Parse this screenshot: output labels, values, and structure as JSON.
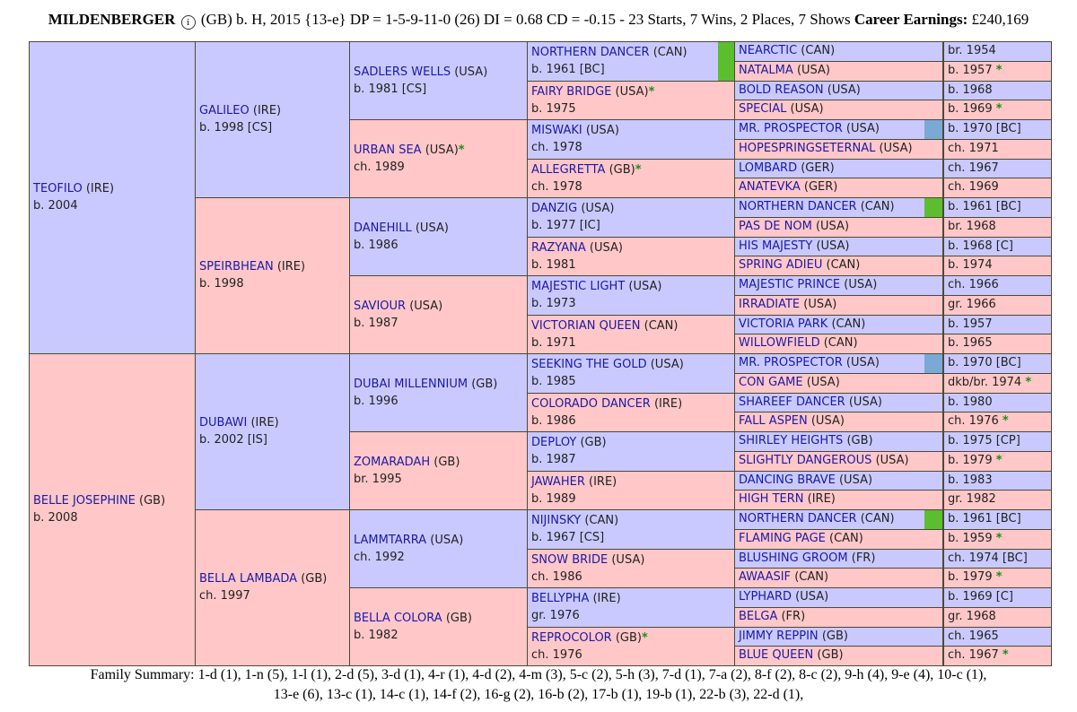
{
  "header": {
    "name": "MILDENBERGER",
    "info_icon": "info-icon",
    "details": "(GB) b. H, 2015 {13-e} DP = 1-5-9-11-0 (26) DI = 0.68   CD = -0.15 - 23 Starts, 7 Wins, 2 Places, 7 Shows",
    "earnings_label": "Career Earnings:",
    "earnings_value": "£240,169"
  },
  "pedigree": {
    "g1": [
      {
        "name": "TEOFILO",
        "country": "(IRE)",
        "info": "b. 2004",
        "sex": "m",
        "star": false
      },
      {
        "name": "BELLE JOSEPHINE",
        "country": "(GB)",
        "info": "b. 2008",
        "sex": "f",
        "star": false
      }
    ],
    "g2": [
      {
        "name": "GALILEO",
        "country": "(IRE)",
        "info": "b. 1998 [CS]",
        "sex": "m",
        "star": false
      },
      {
        "name": "SPEIRBHEAN",
        "country": "(IRE)",
        "info": "b. 1998",
        "sex": "f",
        "star": false
      },
      {
        "name": "DUBAWI",
        "country": "(IRE)",
        "info": "b. 2002 [IS]",
        "sex": "m",
        "star": false
      },
      {
        "name": "BELLA LAMBADA",
        "country": "(GB)",
        "info": "ch. 1997",
        "sex": "f",
        "star": false
      }
    ],
    "g3": [
      {
        "name": "SADLERS WELLS",
        "country": "(USA)",
        "info": "b. 1981 [CS]",
        "sex": "m",
        "star": false
      },
      {
        "name": "URBAN SEA",
        "country": "(USA)",
        "info": "ch. 1989",
        "sex": "f",
        "star": true
      },
      {
        "name": "DANEHILL",
        "country": "(USA)",
        "info": "b. 1986",
        "sex": "m",
        "star": false
      },
      {
        "name": "SAVIOUR",
        "country": "(USA)",
        "info": "b. 1987",
        "sex": "f",
        "star": false
      },
      {
        "name": "DUBAI MILLENNIUM",
        "country": "(GB)",
        "info": "b. 1996",
        "sex": "m",
        "star": false
      },
      {
        "name": "ZOMARADAH",
        "country": "(GB)",
        "info": "br. 1995",
        "sex": "f",
        "star": false
      },
      {
        "name": "LAMMTARRA",
        "country": "(USA)",
        "info": "ch. 1992",
        "sex": "m",
        "star": false
      },
      {
        "name": "BELLA COLORA",
        "country": "(GB)",
        "info": "b. 1982",
        "sex": "f",
        "star": false
      }
    ],
    "g4": [
      {
        "name": "NORTHERN DANCER",
        "country": "(CAN)",
        "info": "b. 1961 [BC]",
        "sex": "m",
        "star": false,
        "swatch": "#5cbd2e"
      },
      {
        "name": "FAIRY BRIDGE",
        "country": "(USA)",
        "info": "b. 1975",
        "sex": "f",
        "star": true
      },
      {
        "name": "MISWAKI",
        "country": "(USA)",
        "info": "ch. 1978",
        "sex": "m",
        "star": false
      },
      {
        "name": "ALLEGRETTA",
        "country": "(GB)",
        "info": "ch. 1978",
        "sex": "f",
        "star": true
      },
      {
        "name": "DANZIG",
        "country": "(USA)",
        "info": "b. 1977 [IC]",
        "sex": "m",
        "star": false
      },
      {
        "name": "RAZYANA",
        "country": "(USA)",
        "info": "b. 1981",
        "sex": "f",
        "star": false
      },
      {
        "name": "MAJESTIC LIGHT",
        "country": "(USA)",
        "info": "b. 1973",
        "sex": "m",
        "star": false
      },
      {
        "name": "VICTORIAN QUEEN",
        "country": "(CAN)",
        "info": "b. 1971",
        "sex": "f",
        "star": false
      },
      {
        "name": "SEEKING THE GOLD",
        "country": "(USA)",
        "info": "b. 1985",
        "sex": "m",
        "star": false
      },
      {
        "name": "COLORADO DANCER",
        "country": "(IRE)",
        "info": "b. 1986",
        "sex": "f",
        "star": false
      },
      {
        "name": "DEPLOY",
        "country": "(GB)",
        "info": "b. 1987",
        "sex": "m",
        "star": false
      },
      {
        "name": "JAWAHER",
        "country": "(IRE)",
        "info": "b. 1989",
        "sex": "f",
        "star": false
      },
      {
        "name": "NIJINSKY",
        "country": "(CAN)",
        "info": "b. 1967 [CS]",
        "sex": "m",
        "star": false
      },
      {
        "name": "SNOW BRIDE",
        "country": "(USA)",
        "info": "ch. 1986",
        "sex": "f",
        "star": false
      },
      {
        "name": "BELLYPHA",
        "country": "(IRE)",
        "info": "gr. 1976",
        "sex": "m",
        "star": false
      },
      {
        "name": "REPROCOLOR",
        "country": "(GB)",
        "info": "ch. 1976",
        "sex": "f",
        "star": true
      }
    ],
    "g5": [
      {
        "name": "NEARCTIC",
        "country": "(CAN)",
        "info": "br. 1954",
        "sex": "m",
        "star": false
      },
      {
        "name": "NATALMA",
        "country": "(USA)",
        "info": "b. 1957",
        "sex": "f",
        "star": true
      },
      {
        "name": "BOLD REASON",
        "country": "(USA)",
        "info": "b. 1968",
        "sex": "m",
        "star": false
      },
      {
        "name": "SPECIAL",
        "country": "(USA)",
        "info": "b. 1969",
        "sex": "f",
        "star": true
      },
      {
        "name": "MR. PROSPECTOR",
        "country": "(USA)",
        "info": "b. 1970 [BC]",
        "sex": "m",
        "star": false,
        "swatch": "#7aa9d6"
      },
      {
        "name": "HOPESPRINGSETERNAL",
        "country": "(USA)",
        "info": "ch. 1971",
        "sex": "f",
        "star": false
      },
      {
        "name": "LOMBARD",
        "country": "(GER)",
        "info": "ch. 1967",
        "sex": "m",
        "star": false
      },
      {
        "name": "ANATEVKA",
        "country": "(GER)",
        "info": "ch. 1969",
        "sex": "f",
        "star": false
      },
      {
        "name": "NORTHERN DANCER",
        "country": "(CAN)",
        "info": "b. 1961 [BC]",
        "sex": "m",
        "star": false,
        "swatch": "#5cbd2e"
      },
      {
        "name": "PAS DE NOM",
        "country": "(USA)",
        "info": "br. 1968",
        "sex": "f",
        "star": false
      },
      {
        "name": "HIS MAJESTY",
        "country": "(USA)",
        "info": "b. 1968 [C]",
        "sex": "m",
        "star": false
      },
      {
        "name": "SPRING ADIEU",
        "country": "(CAN)",
        "info": "b. 1974",
        "sex": "f",
        "star": false
      },
      {
        "name": "MAJESTIC PRINCE",
        "country": "(USA)",
        "info": "ch. 1966",
        "sex": "m",
        "star": false
      },
      {
        "name": "IRRADIATE",
        "country": "(USA)",
        "info": "gr. 1966",
        "sex": "f",
        "star": false
      },
      {
        "name": "VICTORIA PARK",
        "country": "(CAN)",
        "info": "b. 1957",
        "sex": "m",
        "star": false
      },
      {
        "name": "WILLOWFIELD",
        "country": "(CAN)",
        "info": "b. 1965",
        "sex": "f",
        "star": false
      },
      {
        "name": "MR. PROSPECTOR",
        "country": "(USA)",
        "info": "b. 1970 [BC]",
        "sex": "m",
        "star": false,
        "swatch": "#7aa9d6"
      },
      {
        "name": "CON GAME",
        "country": "(USA)",
        "info": "dkb/br. 1974",
        "sex": "f",
        "star": true
      },
      {
        "name": "SHAREEF DANCER",
        "country": "(USA)",
        "info": "b. 1980",
        "sex": "m",
        "star": false
      },
      {
        "name": "FALL ASPEN",
        "country": "(USA)",
        "info": "ch. 1976",
        "sex": "f",
        "star": true
      },
      {
        "name": "SHIRLEY HEIGHTS",
        "country": "(GB)",
        "info": "b. 1975 [CP]",
        "sex": "m",
        "star": false
      },
      {
        "name": "SLIGHTLY DANGEROUS",
        "country": "(USA)",
        "info": "b. 1979",
        "sex": "f",
        "star": true
      },
      {
        "name": "DANCING BRAVE",
        "country": "(USA)",
        "info": "b. 1983",
        "sex": "m",
        "star": false
      },
      {
        "name": "HIGH TERN",
        "country": "(IRE)",
        "info": "gr. 1982",
        "sex": "f",
        "star": false
      },
      {
        "name": "NORTHERN DANCER",
        "country": "(CAN)",
        "info": "b. 1961 [BC]",
        "sex": "m",
        "star": false,
        "swatch": "#5cbd2e"
      },
      {
        "name": "FLAMING PAGE",
        "country": "(CAN)",
        "info": "b. 1959",
        "sex": "f",
        "star": true
      },
      {
        "name": "BLUSHING GROOM",
        "country": "(FR)",
        "info": "ch. 1974 [BC]",
        "sex": "m",
        "star": false
      },
      {
        "name": "AWAASIF",
        "country": "(CAN)",
        "info": "b. 1979",
        "sex": "f",
        "star": true
      },
      {
        "name": "LYPHARD",
        "country": "(USA)",
        "info": "b. 1969 [C]",
        "sex": "m",
        "star": false
      },
      {
        "name": "BELGA",
        "country": "(FR)",
        "info": "gr. 1968",
        "sex": "f",
        "star": false
      },
      {
        "name": "JIMMY REPPIN",
        "country": "(GB)",
        "info": "ch. 1965",
        "sex": "m",
        "star": false
      },
      {
        "name": "BLUE QUEEN",
        "country": "(GB)",
        "info": "ch. 1967",
        "sex": "f",
        "star": true
      }
    ]
  },
  "star_symbol": "*",
  "footer": {
    "line1": "Family Summary: 1-d (1), 1-n (5), 1-l (1), 2-d (5), 3-d (1), 4-r (1), 4-d (2), 4-m (3), 5-c (2), 5-h (3), 7-d (1), 7-a (2), 8-f (2), 8-c (2), 9-h (4), 9-e (4), 10-c (1),",
    "line2": "13-e (6), 13-c (1), 14-c (1), 14-f (2), 16-g (2), 16-b (2), 17-b (1), 19-b (1), 22-b (3), 22-d (1),"
  }
}
